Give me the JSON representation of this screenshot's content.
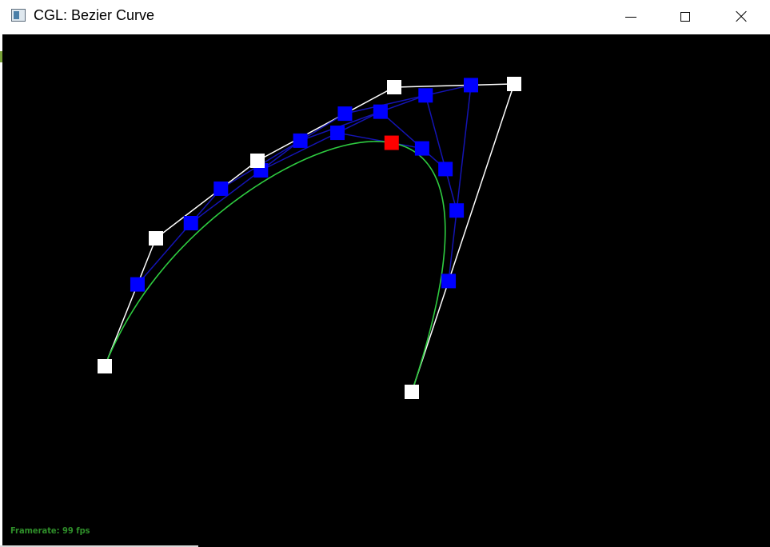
{
  "window": {
    "title": "CGL: Bezier Curve",
    "icon": "app-window-icon"
  },
  "titlebar_buttons": {
    "minimize": "minimize-icon",
    "maximize": "maximize-icon",
    "close": "close-icon"
  },
  "colors": {
    "background": "#000000",
    "control_point": "#ffffff",
    "control_polygon": "#ffffff",
    "intermediate_point": "#0000ff",
    "intermediate_line": "#1414b4",
    "evaluated_point": "#ff0000",
    "curve": "#2ecc40",
    "framerate_text": "#2f8f2a"
  },
  "status": {
    "framerate": "Framerate: 99 fps"
  }
}
